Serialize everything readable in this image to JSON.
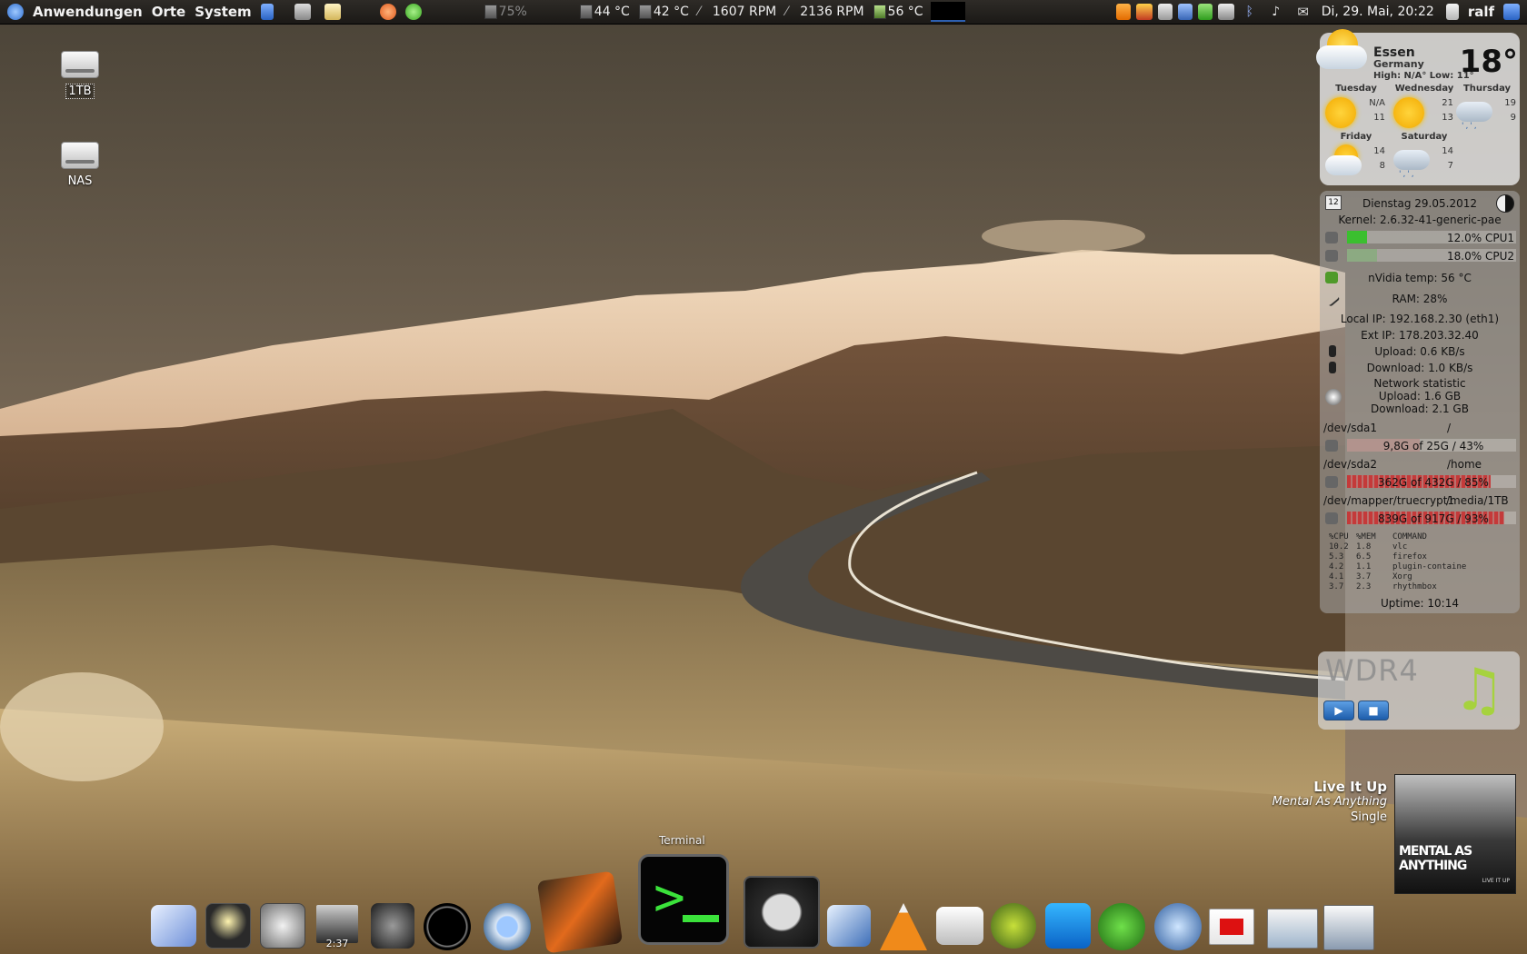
{
  "top_panel": {
    "menus": [
      "Anwendungen",
      "Orte",
      "System"
    ],
    "battery": "75%",
    "sensors": [
      {
        "label": "44 °C",
        "icon": "chip-temp-icon"
      },
      {
        "label": "42 °C",
        "icon": "chip-temp-icon"
      },
      {
        "label": "1607 RPM",
        "icon": "fan-icon"
      },
      {
        "label": "2136 RPM",
        "icon": "fan-icon"
      },
      {
        "label": "56 °C",
        "icon": "gpu-temp-icon"
      }
    ],
    "clock": "Di, 29. Mai, 20:22",
    "user": "ralf"
  },
  "desktop_icons": [
    {
      "label": "1TB",
      "icon": "hard-drive-icon"
    },
    {
      "label": "NAS",
      "icon": "hard-drive-icon"
    }
  ],
  "weather": {
    "city": "Essen",
    "country": "Germany",
    "high_low": "High: N/A°  Low: 11°",
    "current_temp": "18°",
    "forecast": [
      {
        "day": "Tuesday",
        "high": "N/A",
        "low": "11",
        "icon": "sunny-icon"
      },
      {
        "day": "Wednesday",
        "high": "21",
        "low": "13",
        "icon": "sunny-icon"
      },
      {
        "day": "Thursday",
        "high": "19",
        "low": "9",
        "icon": "rain-icon"
      },
      {
        "day": "Friday",
        "high": "14",
        "low": "8",
        "icon": "partly-cloudy-icon"
      },
      {
        "day": "Saturday",
        "high": "14",
        "low": "7",
        "icon": "rain-icon"
      }
    ]
  },
  "conky": {
    "date": "Dienstag 29.05.2012",
    "calendar_day": "12",
    "kernel": "Kernel: 2.6.32-41-generic-pae",
    "cpu1": "12.0% CPU1",
    "cpu2": "18.0% CPU2",
    "cpu1_level": 0.12,
    "cpu2_level": 0.18,
    "gpu_temp": "nVidia temp: 56 °C",
    "ram": "RAM: 28%",
    "local_ip": "Local IP: 192.168.2.30 (eth1)",
    "ext_ip": "Ext IP: 178.203.32.40",
    "upload": "Upload: 0.6 KB/s",
    "download": "Download: 1.0 KB/s",
    "net_stat_title": "Network statistic",
    "net_upload_total": "Upload: 1.6 GB",
    "net_download_total": "Download: 2.1 GB",
    "disks": [
      {
        "device": "/dev/sda1",
        "mount": "/",
        "usage": "9,8G of 25G / 43%",
        "level": 0.43
      },
      {
        "device": "/dev/sda2",
        "mount": "/home",
        "usage": "362G of 432G / 85%",
        "level": 0.85
      },
      {
        "device": "/dev/mapper/truecrypt1",
        "mount": "/media/1TB",
        "usage": "839G of 917G / 93%",
        "level": 0.93
      }
    ],
    "process_header": [
      "%CPU",
      "%MEM",
      "COMMAND"
    ],
    "processes": [
      [
        "10.2",
        "1.8",
        "vlc"
      ],
      [
        "5.3",
        "6.5",
        "firefox"
      ],
      [
        "4.2",
        "1.1",
        "plugin-containe"
      ],
      [
        "4.1",
        "3.7",
        "Xorg"
      ],
      [
        "3.7",
        "2.3",
        "rhythmbox"
      ]
    ],
    "uptime": "Uptime: 10:14"
  },
  "radio": {
    "station": "WDR4"
  },
  "now_playing": {
    "title": "Live It Up",
    "artist": "Mental As Anything",
    "album": "Single",
    "album_art_text": "MENTAL AS ANYTHING",
    "album_art_sub": "LIVE IT UP"
  },
  "dock": {
    "tooltip": "Terminal",
    "badge": "2:37"
  },
  "colors": {
    "panel_bg": "#1f1c19",
    "bar_green": "#3bbf2f",
    "bar_red": "#c43a3a",
    "weather_bg": "#e6e6e6"
  }
}
